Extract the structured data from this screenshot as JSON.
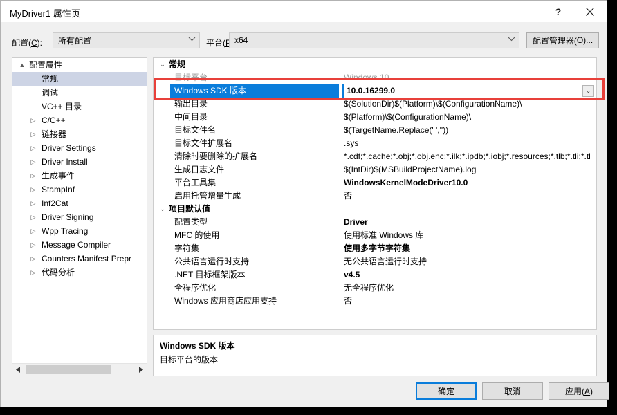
{
  "window": {
    "title": "MyDriver1 属性页",
    "help_icon": "question-mark-icon",
    "help_glyph": "?",
    "close_icon": "close-icon"
  },
  "toolbar": {
    "config_label": "配置(C):",
    "config_label_pre": "配置(",
    "config_label_key": "C",
    "config_label_post": "):",
    "config_value": "所有配置",
    "platform_label_pre": "平台(",
    "platform_label_key": "P",
    "platform_label_post": "):",
    "platform_value": "x64",
    "config_manager_pre": "配置管理器(",
    "config_manager_key": "O",
    "config_manager_post": ")...",
    "dropdown_icon": "chevron-down-icon"
  },
  "tree": {
    "nodes": [
      {
        "label": "配置属性",
        "level": 0,
        "arrow": "▲",
        "expanded": true,
        "selected": false
      },
      {
        "label": "常规",
        "level": 1,
        "arrow": "",
        "expanded": false,
        "selected": true
      },
      {
        "label": "调试",
        "level": 1,
        "arrow": "",
        "expanded": false,
        "selected": false
      },
      {
        "label": "VC++ 目录",
        "level": 1,
        "arrow": "",
        "expanded": false,
        "selected": false
      },
      {
        "label": "C/C++",
        "level": 1,
        "arrow": "▷",
        "expanded": false,
        "selected": false
      },
      {
        "label": "链接器",
        "level": 1,
        "arrow": "▷",
        "expanded": false,
        "selected": false
      },
      {
        "label": "Driver Settings",
        "level": 1,
        "arrow": "▷",
        "expanded": false,
        "selected": false
      },
      {
        "label": "Driver Install",
        "level": 1,
        "arrow": "▷",
        "expanded": false,
        "selected": false
      },
      {
        "label": "生成事件",
        "level": 1,
        "arrow": "▷",
        "expanded": false,
        "selected": false
      },
      {
        "label": "StampInf",
        "level": 1,
        "arrow": "▷",
        "expanded": false,
        "selected": false
      },
      {
        "label": "Inf2Cat",
        "level": 1,
        "arrow": "▷",
        "expanded": false,
        "selected": false
      },
      {
        "label": "Driver Signing",
        "level": 1,
        "arrow": "▷",
        "expanded": false,
        "selected": false
      },
      {
        "label": "Wpp Tracing",
        "level": 1,
        "arrow": "▷",
        "expanded": false,
        "selected": false
      },
      {
        "label": "Message Compiler",
        "level": 1,
        "arrow": "▷",
        "expanded": false,
        "selected": false
      },
      {
        "label": "Counters Manifest Prepr",
        "level": 1,
        "arrow": "▷",
        "expanded": false,
        "selected": false
      },
      {
        "label": "代码分析",
        "level": 1,
        "arrow": "▷",
        "expanded": false,
        "selected": false
      }
    ],
    "scrollbar": {
      "left_arrow": "◀",
      "right_arrow": "▶"
    }
  },
  "grid": {
    "expand_glyph": "⌄",
    "dropdown_glyph": "⌄",
    "rows": [
      {
        "kind": "category",
        "name": "常规"
      },
      {
        "kind": "prop",
        "name": "目标平台",
        "value": "Windows 10",
        "disabled": true,
        "bold": false,
        "selected": false
      },
      {
        "kind": "prop",
        "name": "Windows SDK 版本",
        "value": "10.0.16299.0",
        "disabled": false,
        "bold": true,
        "selected": true
      },
      {
        "kind": "prop",
        "name": "输出目录",
        "value": "$(SolutionDir)$(Platform)\\$(ConfigurationName)\\",
        "disabled": false,
        "bold": false,
        "selected": false
      },
      {
        "kind": "prop",
        "name": "中间目录",
        "value": "$(Platform)\\$(ConfigurationName)\\",
        "disabled": false,
        "bold": false,
        "selected": false
      },
      {
        "kind": "prop",
        "name": "目标文件名",
        "value": "$(TargetName.Replace(' ',''))",
        "disabled": false,
        "bold": false,
        "selected": false
      },
      {
        "kind": "prop",
        "name": "目标文件扩展名",
        "value": ".sys",
        "disabled": false,
        "bold": false,
        "selected": false
      },
      {
        "kind": "prop",
        "name": "清除时要删除的扩展名",
        "value": "*.cdf;*.cache;*.obj;*.obj.enc;*.ilk;*.ipdb;*.iobj;*.resources;*.tlb;*.tli;*.tl",
        "disabled": false,
        "bold": false,
        "selected": false
      },
      {
        "kind": "prop",
        "name": "生成日志文件",
        "value": "$(IntDir)$(MSBuildProjectName).log",
        "disabled": false,
        "bold": false,
        "selected": false
      },
      {
        "kind": "prop",
        "name": "平台工具集",
        "value": "WindowsKernelModeDriver10.0",
        "disabled": false,
        "bold": true,
        "selected": false
      },
      {
        "kind": "prop",
        "name": "启用托管增量生成",
        "value": "否",
        "disabled": false,
        "bold": false,
        "selected": false
      },
      {
        "kind": "category",
        "name": "项目默认值"
      },
      {
        "kind": "prop",
        "name": "配置类型",
        "value": "Driver",
        "disabled": false,
        "bold": true,
        "selected": false
      },
      {
        "kind": "prop",
        "name": "MFC 的使用",
        "value": "使用标准 Windows 库",
        "disabled": false,
        "bold": false,
        "selected": false
      },
      {
        "kind": "prop",
        "name": "字符集",
        "value": "使用多字节字符集",
        "disabled": false,
        "bold": true,
        "selected": false
      },
      {
        "kind": "prop",
        "name": "公共语言运行时支持",
        "value": "无公共语言运行时支持",
        "disabled": false,
        "bold": false,
        "selected": false
      },
      {
        "kind": "prop",
        "name": ".NET 目标框架版本",
        "value": "v4.5",
        "disabled": false,
        "bold": true,
        "selected": false
      },
      {
        "kind": "prop",
        "name": "全程序优化",
        "value": "无全程序优化",
        "disabled": false,
        "bold": false,
        "selected": false
      },
      {
        "kind": "prop",
        "name": "Windows 应用商店应用支持",
        "value": "否",
        "disabled": false,
        "bold": false,
        "selected": false
      }
    ]
  },
  "description": {
    "title": "Windows SDK 版本",
    "body": "目标平台的版本"
  },
  "footer": {
    "ok": "确定",
    "cancel": "取消",
    "apply_pre": "应用(",
    "apply_key": "A",
    "apply_post": ")"
  },
  "colors": {
    "selection_blue": "#0a7ddb",
    "annotation_red": "#e8403a",
    "tree_selection": "#cdd4e5",
    "dialog_bg": "#f0f0f0"
  }
}
